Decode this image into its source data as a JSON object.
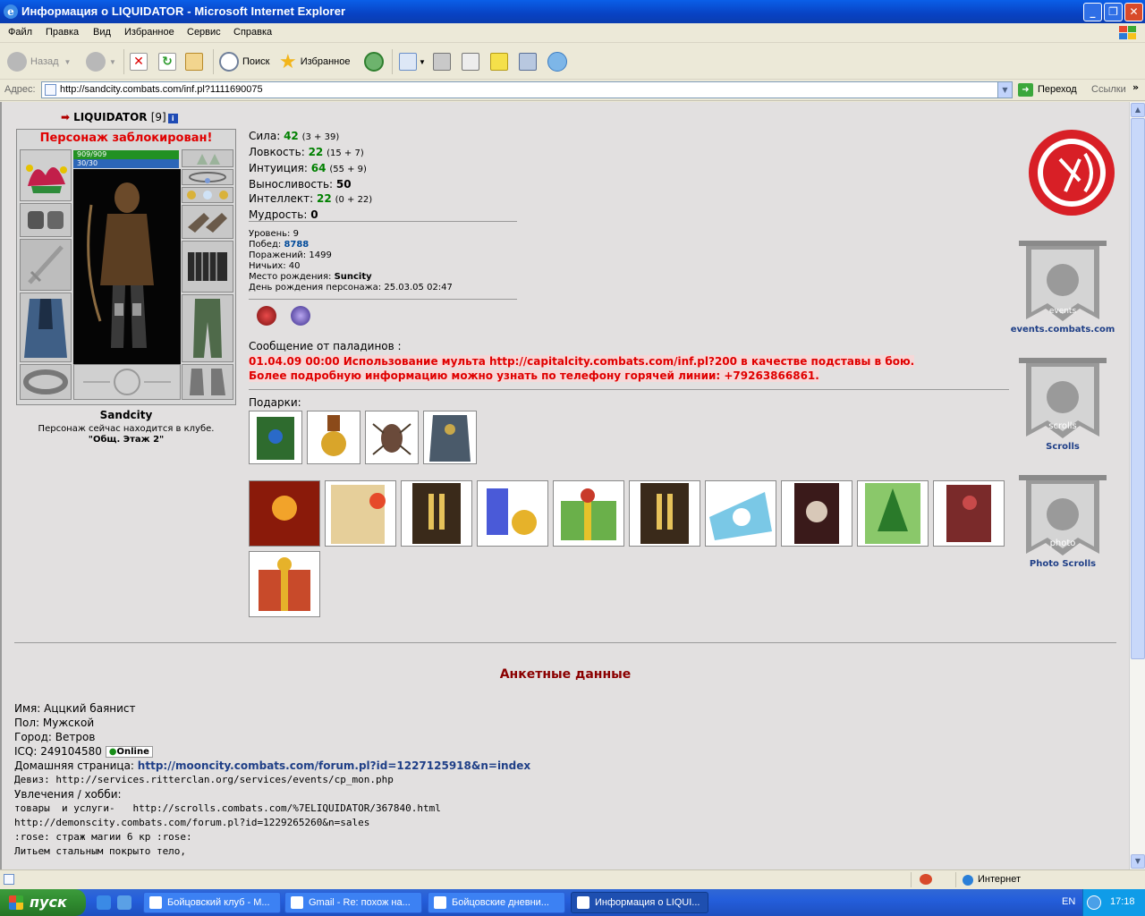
{
  "window": {
    "title": "Информация о LIQUIDATOR - Microsoft Internet Explorer"
  },
  "menu": [
    "Файл",
    "Правка",
    "Вид",
    "Избранное",
    "Сервис",
    "Справка"
  ],
  "toolbar": {
    "back": "Назад",
    "search": "Поиск",
    "favorites": "Избранное"
  },
  "address": {
    "label": "Адрес:",
    "url": "http://sandcity.combats.com/inf.pl?1111690075",
    "go": "Переход",
    "links": "Ссылки"
  },
  "character": {
    "nick": "LIQUIDATOR",
    "level": "[9]",
    "blocked": "Персонаж заблокирован!",
    "hp": "909/909",
    "mp": "30/30",
    "city": "Sandcity",
    "club_text": "Персонаж сейчас находится в клубе.",
    "club_room": "\"Общ. Этаж 2\""
  },
  "stats": {
    "strength": {
      "label": "Сила:",
      "value": "42",
      "detail": "(3 + 39)"
    },
    "agility": {
      "label": "Ловкость:",
      "value": "22",
      "detail": "(15 + 7)"
    },
    "intuition": {
      "label": "Интуиция:",
      "value": "64",
      "detail": "(55 + 9)"
    },
    "endurance": {
      "label": "Выносливость:",
      "value": "50"
    },
    "intellect": {
      "label": "Интеллект:",
      "value": "22",
      "detail": "(0 + 22)"
    },
    "wisdom": {
      "label": "Мудрость:",
      "value": "0"
    }
  },
  "info": {
    "level": {
      "label": "Уровень:",
      "value": "9"
    },
    "wins": {
      "label": "Побед:",
      "value": "8788"
    },
    "losses": {
      "label": "Поражений:",
      "value": "1499"
    },
    "draws": {
      "label": "Ничьих:",
      "value": "40"
    },
    "birthplace": {
      "label": "Место рождения:",
      "value": "Suncity"
    },
    "birthday": {
      "label": "День рождения персонажа:",
      "value": "25.03.05 02:47"
    }
  },
  "paladins": {
    "heading": "Сообщение от паладинов :",
    "line1": "01.04.09 00:00 Использование мульта http://capitalcity.combats.com/inf.pl?200 в качестве подставы в бою.",
    "line2": "Более подробную информацию можно узнать по телефону горячей линии: +79263866861."
  },
  "gifts_heading": "Подарки:",
  "side": {
    "events": "events.combats.com",
    "scrolls": "Scrolls",
    "photo": "Photo Scrolls",
    "events_word": "events",
    "scrolls_word": "scrolls",
    "photo_word": "photo"
  },
  "anketa": {
    "heading": "Анкетные данные",
    "name": "Имя: Аццкий баянист",
    "sex": "Пол: Мужской",
    "city": "Город: Ветров",
    "icq": "ICQ: 249104580",
    "online": "Online",
    "homepage_label": "Домашняя страница: ",
    "homepage": "http://mooncity.combats.com/forum.pl?id=1227125918&n=index",
    "motto": "Девиз: http://services.ritterclan.org/services/events/cp_mon.php",
    "hobby": "Увлечения / хобби:",
    "h1": "товары  и услуги-   http://scrolls.combats.com/%7ELIQUIDATOR/367840.html",
    "h2": "http://demonscity.combats.com/forum.pl?id=1229265260&n=sales",
    "h3": ":rose: страж магии 6 кр :rose:",
    "h4": "Литьем стальным покрыто тело,"
  },
  "status": {
    "zone": "Интернет"
  },
  "taskbar": {
    "start": "пуск",
    "tasks": [
      "Бойцовский клуб - М...",
      "Gmail - Re: похож на...",
      "Бойцовские дневни...",
      "Информация о LIQUI..."
    ],
    "lang": "EN",
    "time": "17:18"
  }
}
